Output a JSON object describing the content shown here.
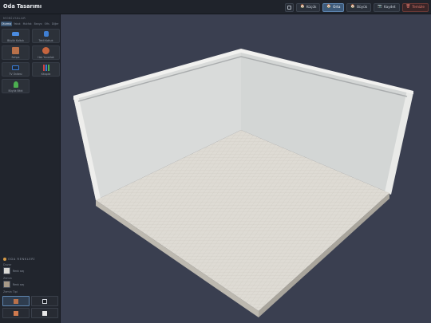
{
  "app": {
    "title": "Oda Tasarımı"
  },
  "toolbar": {
    "square_icon": "square-icon",
    "size_small": "Küçük",
    "size_medium": "Orta",
    "size_large": "Büyük",
    "save": "Kaydet",
    "reset": "Temizle",
    "active_size": "Orta"
  },
  "sidebar": {
    "title": "MOBİLYALAR",
    "tabs": [
      "Oturma",
      "Yatak",
      "Mutfak",
      "Banyo",
      "Ofis",
      "Diğer"
    ],
    "active_tab": "Oturma",
    "items": [
      {
        "label": "Büyük Koltuk",
        "icon": "sofa-icon",
        "glyph": "🛋",
        "color": "#4a8be0"
      },
      {
        "label": "Tekli Koltuk",
        "icon": "armchair-icon",
        "glyph": "💺",
        "color": "#4a8be0"
      },
      {
        "label": "Sehpa",
        "icon": "table-icon",
        "glyph": "",
        "color": "#b9714a"
      },
      {
        "label": "Halı Yuvarlak",
        "icon": "rug-icon",
        "glyph": "",
        "color": "#c6653f"
      },
      {
        "label": "TV Ünitesi",
        "icon": "tv-icon",
        "glyph": "📺",
        "color": "#3a7bd5"
      },
      {
        "label": "Kitaplık",
        "icon": "books-icon",
        "glyph": "📚",
        "color": "#c44"
      },
      {
        "label": "Büyük Bitki",
        "icon": "plant-icon",
        "glyph": "🌱",
        "color": "#4caf50"
      }
    ]
  },
  "room_colors": {
    "title": "ODA RENKLERİ",
    "wall_label": "Duvar",
    "wall_value": "Renk seç",
    "wall_color": "#d9d8d4",
    "floor_label": "Zemin",
    "floor_value": "Renk seç",
    "floor_color": "#a89a88",
    "texture_label": "Zemin Tipi",
    "textures": [
      {
        "name": "brick",
        "color": "#b9714a",
        "active": true
      },
      {
        "name": "dark-square",
        "color": "#1b1e24",
        "active": false
      },
      {
        "name": "tile",
        "color": "#d07a4e",
        "active": false
      },
      {
        "name": "light-square",
        "color": "#e6e6e6",
        "active": false
      }
    ]
  },
  "scene": {
    "wall_color": "#d7d9d8",
    "wall_shade": "#c9ccca",
    "floor_color": "#dedbd4",
    "trim_color": "#eeeeec",
    "background": "#3a3f50"
  }
}
